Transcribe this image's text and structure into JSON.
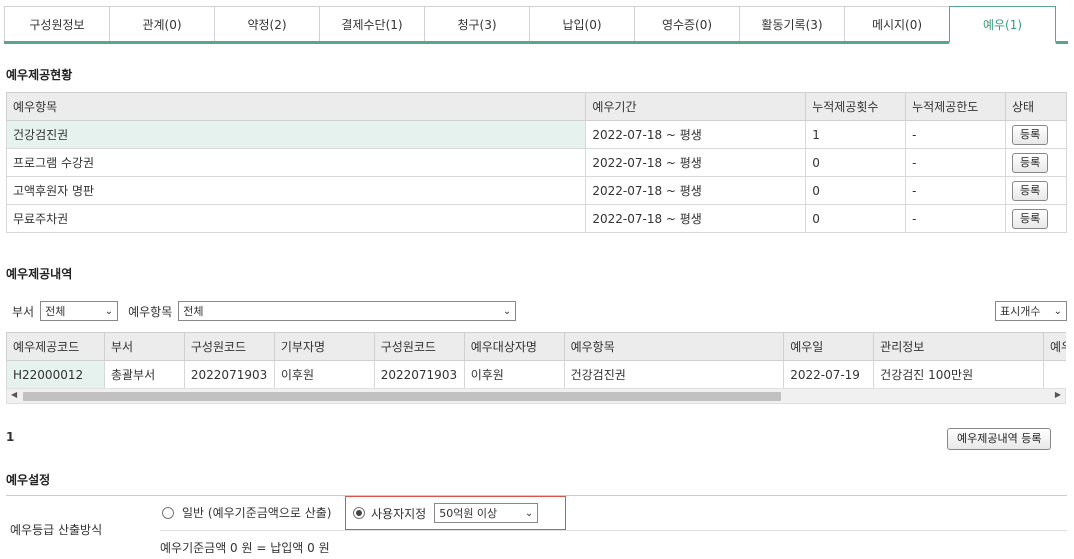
{
  "tabs": [
    "구성원정보",
    "관계(0)",
    "약정(2)",
    "결제수단(1)",
    "청구(3)",
    "납입(0)",
    "영수증(0)",
    "활동기록(3)",
    "메시지(0)",
    "예우(1)"
  ],
  "section1": {
    "title": "예우제공현황",
    "headers": [
      "예우항목",
      "예우기간",
      "누적제공횟수",
      "누적제공한도",
      "상태"
    ],
    "rows": [
      {
        "item": "건강검진권",
        "period": "2022-07-18 ~ 평생",
        "count": "1",
        "limit": "-",
        "action": "등록"
      },
      {
        "item": "프로그램 수강권",
        "period": "2022-07-18 ~ 평생",
        "count": "0",
        "limit": "-",
        "action": "등록"
      },
      {
        "item": "고액후원자 명판",
        "period": "2022-07-18 ~ 평생",
        "count": "0",
        "limit": "-",
        "action": "등록"
      },
      {
        "item": "무료주차권",
        "period": "2022-07-18 ~ 평생",
        "count": "0",
        "limit": "-",
        "action": "등록"
      }
    ]
  },
  "section2": {
    "title": "예우제공내역",
    "filter_dept_label": "부서",
    "filter_dept_value": "전체",
    "filter_item_label": "예우항목",
    "filter_item_value": "전체",
    "display_count": "표시개수",
    "headers": [
      "예우제공코드",
      "부서",
      "구성원코드",
      "기부자명",
      "구성원코드",
      "예우대상자명",
      "예우항목",
      "예우일",
      "관리정보",
      "예우"
    ],
    "row": [
      "H22000012",
      "총괄부서",
      "2022071903",
      "이후원",
      "2022071903",
      "이후원",
      "건강검진권",
      "2022-07-19",
      "건강검진 100만원",
      ""
    ],
    "total": "1",
    "register_button": "예우제공내역 등록"
  },
  "section3": {
    "title": "예우설정",
    "label": "예우등급 산출방식",
    "option1": "일반 (예우기준금액으로 산출)",
    "option2": "사용자지정",
    "option2_value": "50억원 이상",
    "formula": "예우기준금액 0 원 = 납입액 0 원"
  },
  "colors": {
    "accent": "#5aa68a",
    "highlight": "#e6f2ee",
    "red_box": "#d9534f"
  }
}
